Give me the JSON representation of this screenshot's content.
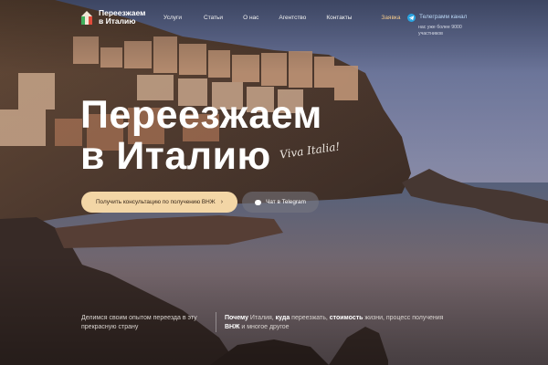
{
  "brand": {
    "name_line1": "Переезжаем",
    "name_line2": "в Италию"
  },
  "nav": {
    "items": [
      "Услуги",
      "Статьи",
      "О нас",
      "Агентство",
      "Контакты",
      "Заявка"
    ]
  },
  "telegram": {
    "label": "Телеграмм канал",
    "subtitle": "нас уже более 9000 участников"
  },
  "hero": {
    "title_line1": "Переезжаем",
    "title_line2": "в Италию",
    "script_caption": "Viva Italia!",
    "primary_button": "Получить консультацию по получению ВНЖ",
    "primary_button_arrow": "›",
    "secondary_button": "Чат в Telegram"
  },
  "bottom": {
    "left_text": "Делимся своим опытом переезда в эту прекрасную страну",
    "right": {
      "w1": "Почему",
      "t1": " Италия, ",
      "w2": "куда",
      "t2": " переезжать, ",
      "w3": "стоимость",
      "t3": " жизни, процесс получения ",
      "w4": "ВНЖ",
      "t4": " и многое другое"
    }
  },
  "colors": {
    "accent_gold": "#f3d6a6",
    "nav_accent": "#f2c88a",
    "telegram_blue": "#2aa3e0"
  }
}
